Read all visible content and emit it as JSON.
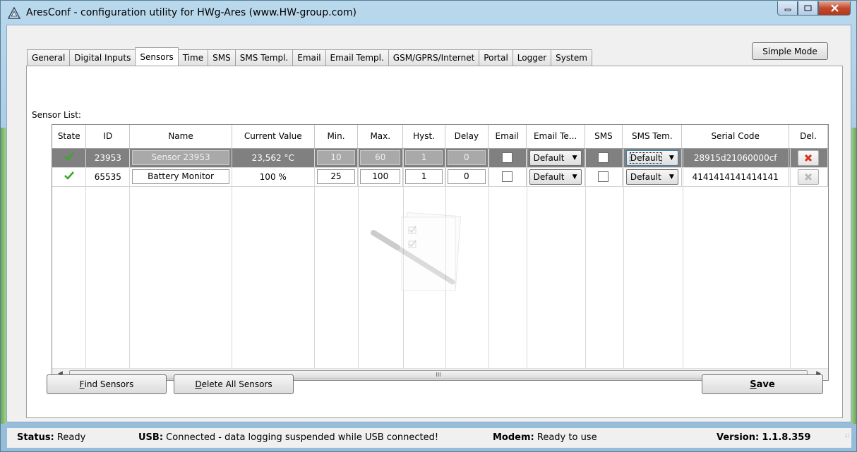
{
  "window": {
    "title": "AresConf - configuration utility for HWg-Ares (www.HW-group.com)"
  },
  "tabs": [
    {
      "label": "General"
    },
    {
      "label": "Digital Inputs"
    },
    {
      "label": "Sensors",
      "active": true
    },
    {
      "label": "Time"
    },
    {
      "label": "SMS"
    },
    {
      "label": "SMS Templ."
    },
    {
      "label": "Email"
    },
    {
      "label": "Email Templ."
    },
    {
      "label": "GSM/GPRS/Internet"
    },
    {
      "label": "Portal"
    },
    {
      "label": "Logger"
    },
    {
      "label": "System"
    }
  ],
  "simple_mode_label": "Simple Mode",
  "sensor_list_label": "Sensor List:",
  "grid": {
    "columns": [
      "State",
      "ID",
      "Name",
      "Current Value",
      "Min.",
      "Max.",
      "Hyst.",
      "Delay",
      "Email",
      "Email Te...",
      "SMS",
      "SMS Tem.",
      "Serial Code",
      "Del."
    ],
    "rows": [
      {
        "state": "ok",
        "id": "23953",
        "name": "Sensor 23953",
        "value": "23,562 °C",
        "min": "10",
        "max": "60",
        "hyst": "1",
        "delay": "0",
        "email": false,
        "email_template": "Default",
        "sms": false,
        "sms_template": "Default",
        "serial": "28915d21060000cf",
        "selected": true
      },
      {
        "state": "ok",
        "id": "65535",
        "name": "Battery Monitor",
        "value": "100 %",
        "min": "25",
        "max": "100",
        "hyst": "1",
        "delay": "0",
        "email": false,
        "email_template": "Default",
        "sms": false,
        "sms_template": "Default",
        "serial": "4141414141414141",
        "selected": false
      }
    ],
    "scroll_grip": "III"
  },
  "buttons": {
    "find": {
      "pre": "",
      "mnemonic": "F",
      "post": "ind Sensors"
    },
    "delete_all": {
      "pre": "",
      "mnemonic": "D",
      "post": "elete All Sensors"
    },
    "save": {
      "pre": "",
      "mnemonic": "S",
      "post": "ave"
    }
  },
  "status": {
    "status_label": "Status:",
    "status_value": "Ready",
    "usb_label": "USB:",
    "usb_value": "Connected - data logging suspended while USB connected!",
    "modem_label": "Modem:",
    "modem_value": "Ready to use",
    "version_label": "Version:",
    "version_value": "1.1.8.359"
  },
  "colors": {
    "selected_row": "#808080",
    "check_green": "#3aa829",
    "delete_red": "#d9301c",
    "title_bar": "#a5c9e3"
  },
  "icons": {
    "app": "triangle-icon",
    "state": "checkmark-icon",
    "delete": "x-icon",
    "watermark": "notepad-pen-icon"
  }
}
